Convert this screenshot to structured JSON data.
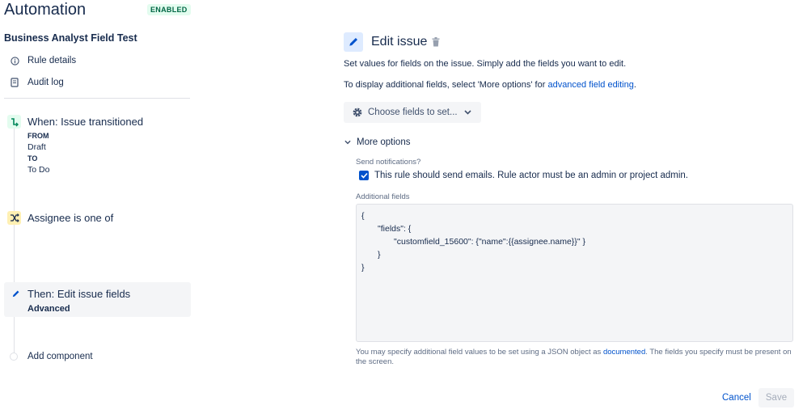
{
  "header": {
    "title": "Automation",
    "badge": "ENABLED"
  },
  "sidebar": {
    "rule_name": "Business Analyst Field Test",
    "nav": [
      {
        "label": "Rule details",
        "icon": "info-icon"
      },
      {
        "label": "Audit log",
        "icon": "document-icon"
      }
    ],
    "trigger": {
      "title": "When: Issue transitioned",
      "from_label": "FROM",
      "from_value": "Draft",
      "to_label": "TO",
      "to_value": "To Do"
    },
    "condition": {
      "title": "Assignee is one of"
    },
    "action": {
      "title": "Then: Edit issue fields",
      "subtitle": "Advanced"
    },
    "add_component": "Add component"
  },
  "main": {
    "title": "Edit issue",
    "description": "Set values for fields on the issue. Simply add the fields you want to edit.",
    "more_info_prefix": "To display additional fields, select 'More options' for ",
    "more_info_link": "advanced field editing",
    "more_info_suffix": ".",
    "choose_fields_label": "Choose fields to set...",
    "more_options_label": "More options",
    "send_notifications_label": "Send notifications?",
    "send_notifications_checkbox": "This rule should send emails. Rule actor must be an admin or project admin.",
    "send_notifications_checked": true,
    "additional_fields_label": "Additional fields",
    "json_lines": [
      "{",
      "\"fields\": {",
      "\"customfield_15600\": {\"name\":{{assignee.name}}\" }",
      "}",
      "}"
    ],
    "help_prefix": "You may specify additional field values to be set using a JSON object as ",
    "help_link": "documented",
    "help_suffix": ". The fields you specify must be present on the screen.",
    "cancel_label": "Cancel",
    "save_label": "Save"
  },
  "colors": {
    "link": "#0052cc",
    "enabled_badge_bg": "#e3fcef",
    "enabled_badge_text": "#006644",
    "trigger_icon": "#00875a",
    "condition_icon_bg": "#fff0b3"
  }
}
